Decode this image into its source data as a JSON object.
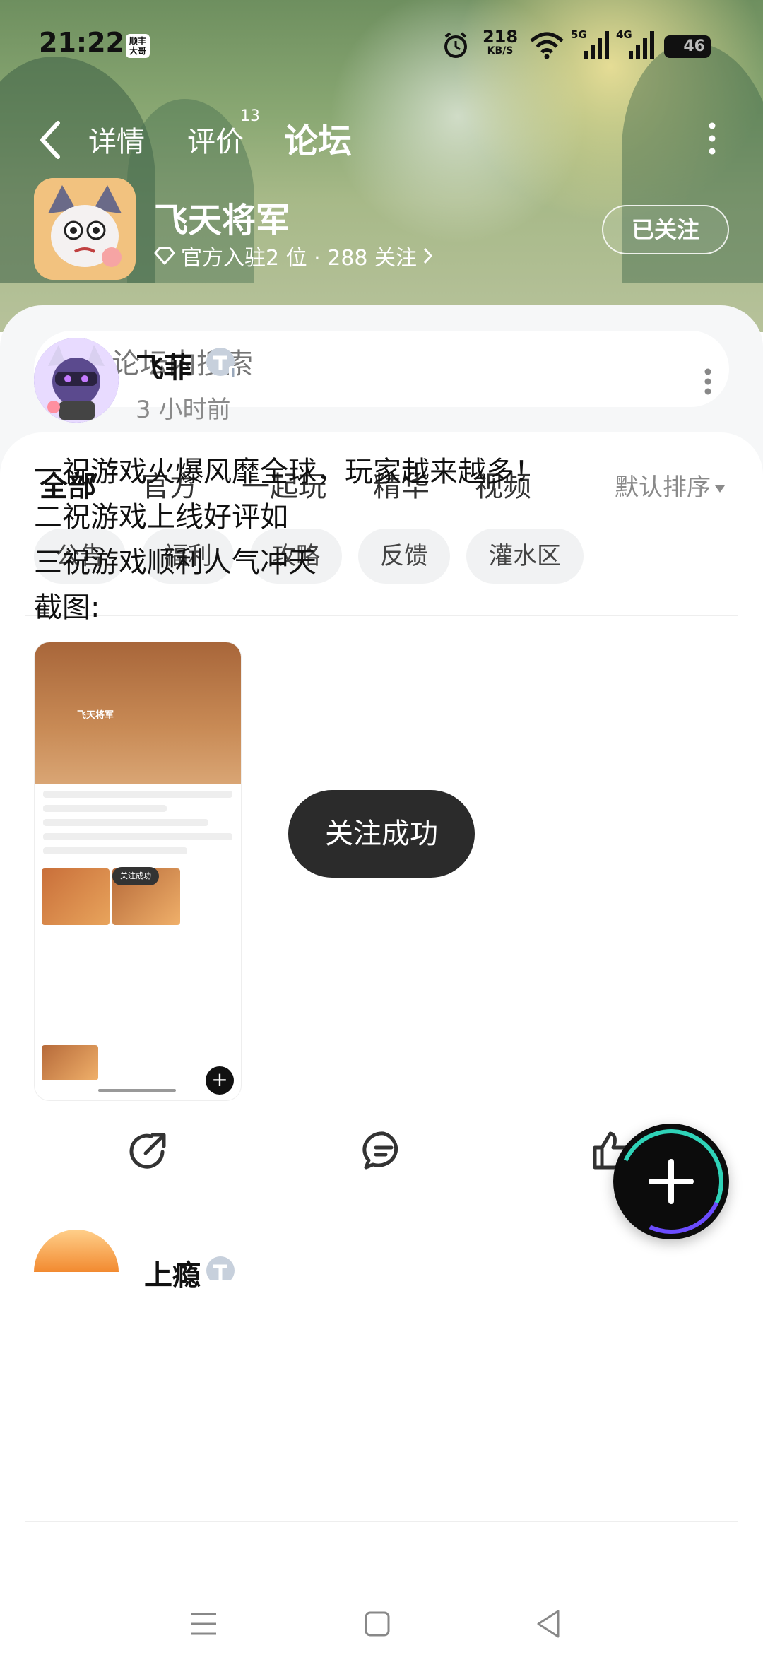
{
  "status_bar": {
    "time": "21:22",
    "badge": "顺丰\n大哥",
    "net_speed": "218",
    "net_unit": "KB/S",
    "sig1": "5G",
    "sig2": "4G",
    "battery": "46"
  },
  "nav": {
    "tabs": [
      {
        "label": "详情"
      },
      {
        "label": "评价",
        "count": "13"
      },
      {
        "label": "论坛"
      }
    ]
  },
  "game": {
    "name": "飞天将军",
    "meta": "官方入驻2 位 · 288 关注",
    "follow_label": "已关注"
  },
  "search": {
    "placeholder": "论坛内搜索"
  },
  "categories": [
    "全部",
    "官方",
    "一起玩",
    "精华",
    "视频"
  ],
  "sort_label": "默认排序",
  "chips": [
    "公告",
    "福利",
    "攻略",
    "反馈",
    "灌水区"
  ],
  "post": {
    "author": "飞菲",
    "time": "3 小时前",
    "lines": [
      "一祝游戏火爆风靡全球，玩家越来越多！",
      "二祝游戏上线好评如",
      "三祝游戏顺利人气冲天",
      "截图:"
    ],
    "screenshot_title": "飞天将军",
    "screenshot_toast": "关注成功"
  },
  "next_post": {
    "author": "上瘾"
  },
  "toast": "关注成功",
  "colors": {
    "accent": "#2fd3b8",
    "toast_bg": "#2b2b2b",
    "fab_bg": "#0c0c0c"
  }
}
